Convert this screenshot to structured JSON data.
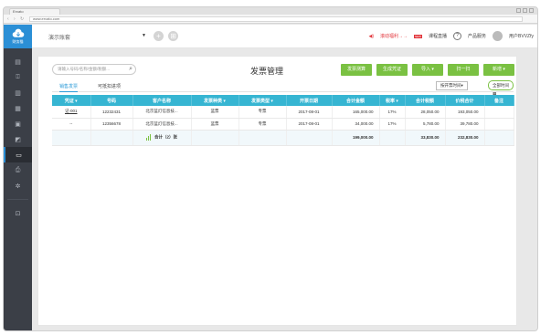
{
  "browser": {
    "tab_title": "Ervato",
    "url": "www.ervato.com"
  },
  "sidebar": {
    "logo_label": "财务猫",
    "items": [
      {
        "icon": "book-icon"
      },
      {
        "icon": "upload-doc-icon"
      },
      {
        "icon": "bar-chart-icon"
      },
      {
        "icon": "building-icon"
      },
      {
        "icon": "document-icon"
      },
      {
        "icon": "image-icon"
      },
      {
        "icon": "invoice-icon",
        "active": true
      },
      {
        "icon": "printer-icon"
      },
      {
        "icon": "settings-icon"
      },
      {
        "icon": "exit-icon"
      }
    ]
  },
  "topbar": {
    "account": "演示账套",
    "notice": "滚动福利→→",
    "course": "课程直播",
    "service": "产品服务",
    "user": "用户BVVZfy"
  },
  "page": {
    "search_placeholder": "请输入号码/名称/金额/税额...",
    "title": "发票管理",
    "buttons": {
      "scan": "发票测算",
      "voucher": "生成凭证",
      "import": "导入 ▾",
      "sweep": "扫一扫",
      "add": "新增 ▾"
    },
    "tabs": [
      "销售发票",
      "可抵扣进项"
    ],
    "sort": "按开票时间▾",
    "time": "全部时间"
  },
  "table": {
    "headers": [
      "凭证 ▾",
      "号码",
      "客户名称",
      "发票种类 ▾",
      "发票类型 ▾",
      "开票日期",
      "合计金额",
      "税率 ▾",
      "合计税额",
      "价税合计",
      "备注"
    ],
    "rows": [
      [
        "记-001",
        "12232431",
        "北京蓝灯信息技...",
        "蓝票",
        "专票",
        "2017-08-01",
        "165,000.00",
        "17%",
        "28,050.00",
        "193,050.00",
        ""
      ],
      [
        "--",
        "12356678",
        "北京蓝灯信息技...",
        "蓝票",
        "专票",
        "2017-08-01",
        "34,000.00",
        "17%",
        "5,780.00",
        "39,780.00",
        ""
      ]
    ],
    "total": {
      "label": "合计（2）张",
      "amount": "199,000.00",
      "tax": "33,830.00",
      "sum": "232,830.00"
    }
  },
  "colors": {
    "accent_green": "#7ac142",
    "header_blue": "#36b5d2",
    "sidebar_dark": "#3b3f47",
    "logo_blue": "#2b8fd6"
  }
}
